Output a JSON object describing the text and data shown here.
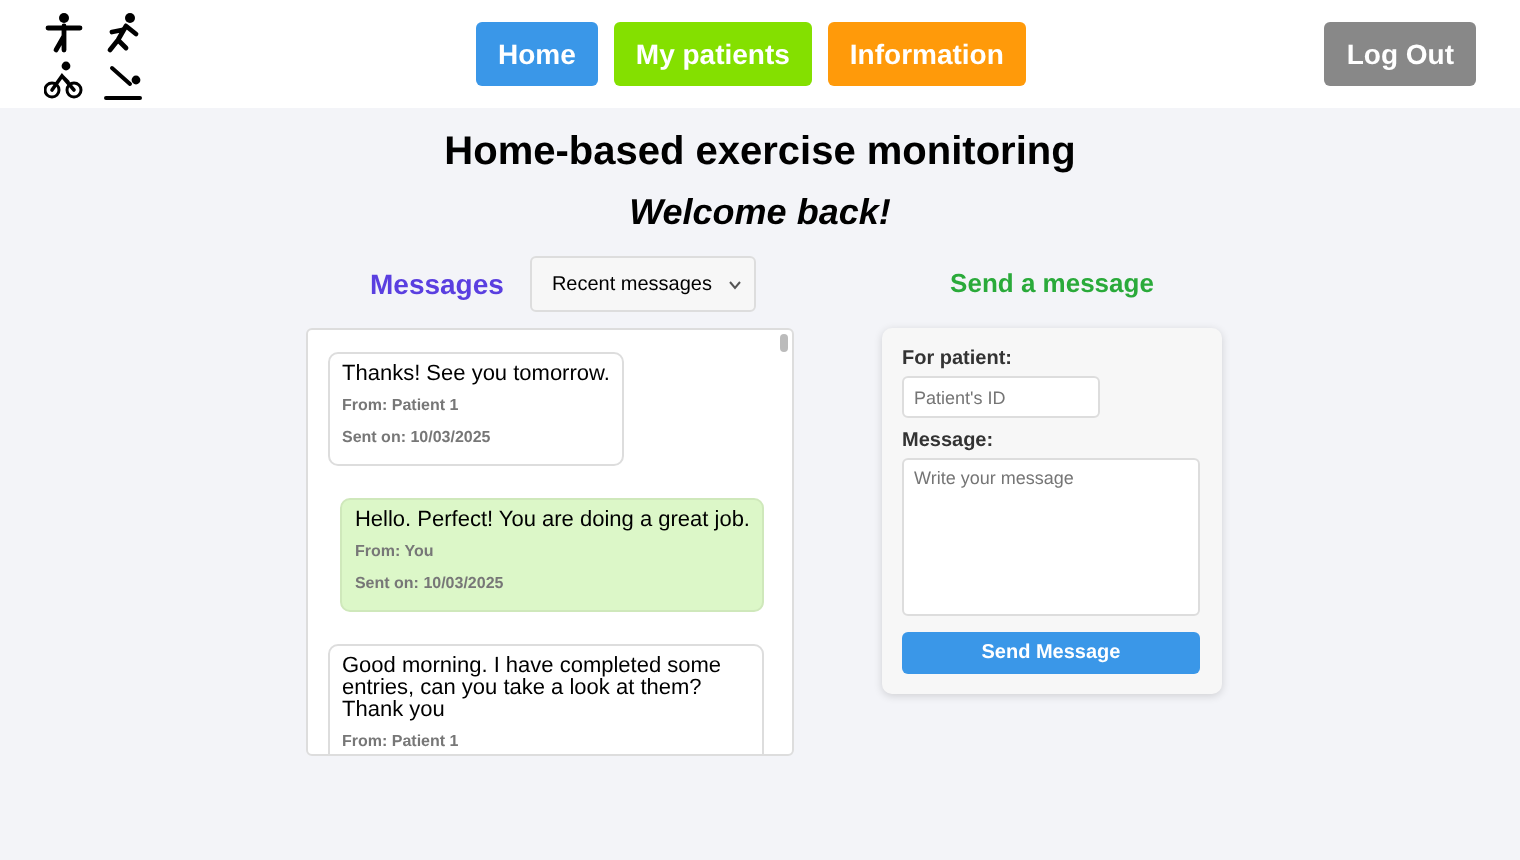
{
  "nav": [
    {
      "label": "Home",
      "color": "#3a97e8"
    },
    {
      "label": "My patients",
      "color": "#84e000"
    },
    {
      "label": "Information",
      "color": "#ff9a0a"
    }
  ],
  "logout": "Log Out",
  "title": "Home-based exercise monitoring",
  "subtitle": "Welcome back!",
  "messages": {
    "heading": "Messages",
    "filter": "Recent messages",
    "items": [
      {
        "kind": "received",
        "text": "Thanks! See you tomorrow.",
        "from": "From: Patient 1",
        "sent": "Sent on: 10/03/2025"
      },
      {
        "kind": "sent",
        "text": "Hello. Perfect! You are doing a great job.",
        "from": "From: You",
        "sent": "Sent on: 10/03/2025"
      },
      {
        "kind": "received",
        "text": "Good morning. I have completed some entries, can you take a look at them? Thank you",
        "from": "From: Patient 1"
      }
    ]
  },
  "send": {
    "heading": "Send a message",
    "patient_label": "For patient:",
    "patient_placeholder": "Patient's ID",
    "message_label": "Message:",
    "message_placeholder": "Write your message",
    "button": "Send Message"
  }
}
